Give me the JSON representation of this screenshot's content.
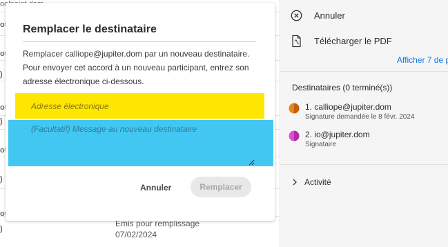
{
  "background_list": {
    "edge_fragments": [
      "oolpoint.dom",
      "ot",
      "ot",
      ")",
      "ot",
      ")",
      "ot",
      ")",
      "ot",
      ")"
    ],
    "status_line": "Émis pour remplissage",
    "status_date": "07/02/2024"
  },
  "right_panel": {
    "cancel_label": "Annuler",
    "download_label": "Télécharger le PDF",
    "show_more_link": "Afficher 7 de p",
    "recipients_heading": "Destinataires (0 terminé(s))",
    "recipients": [
      {
        "name": "1. calliope@jupiter.dom",
        "status": "Signature demandée le 8 févr. 2024",
        "color": "#e68619",
        "accent": "#c45d0a"
      },
      {
        "name": "2. io@jupiter.dom",
        "status": "Signataire",
        "color": "#d94fd1",
        "accent": "#b02da8"
      }
    ],
    "activity_label": "Activité"
  },
  "dialog": {
    "title": "Remplacer le destinataire",
    "description": "Remplacer calliope@jupiter.dom par un nouveau destinataire. Pour envoyer cet accord à un nouveau participant, entrez son adresse électronique ci-dessous.",
    "email_placeholder": "Adresse électronique",
    "message_placeholder": "(Facultatif) Message au nouveau destinataire",
    "cancel_label": "Annuler",
    "replace_label": "Remplacer"
  },
  "colors": {
    "email_highlight": "#ffe600",
    "message_highlight": "#41c7f2",
    "link": "#1473e6"
  }
}
